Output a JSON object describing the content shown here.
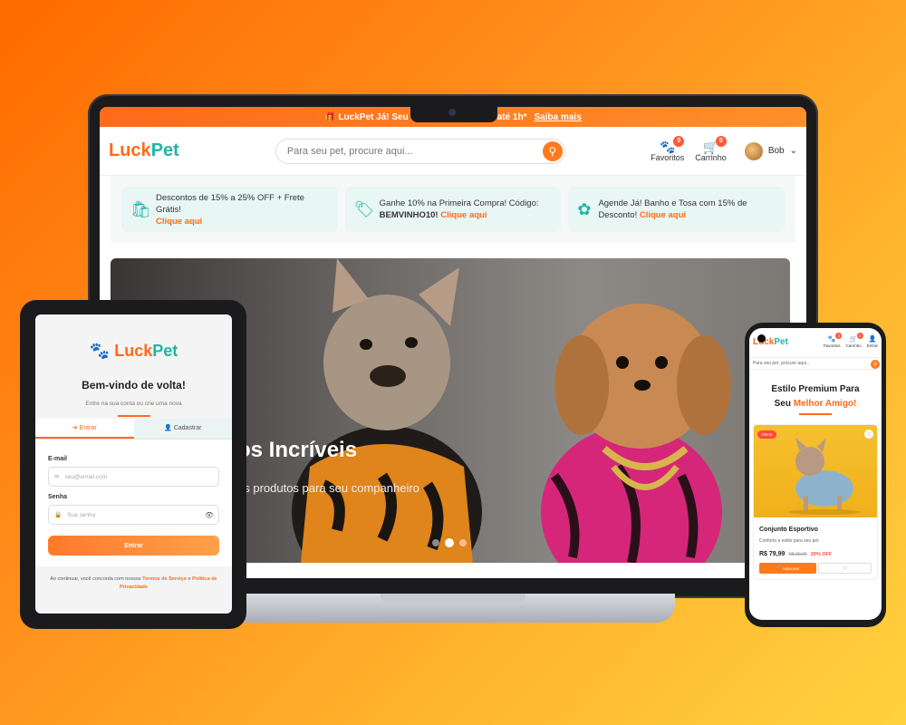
{
  "brand": {
    "part1": "Luck",
    "part2": "Pet",
    "orange": "#ff6a1a",
    "teal": "#1fb5a8"
  },
  "laptop": {
    "topbar": {
      "left": "🎁 LuckPet Já! Seu",
      "right": "até 1h*",
      "link": "Saiba mais"
    },
    "search_placeholder": "Para seu pet, procure aqui...",
    "header_icons": [
      {
        "icon": "paw-icon",
        "label": "Favoritos",
        "count": "0"
      },
      {
        "icon": "cart-icon",
        "label": "Carrinho",
        "count": "0"
      }
    ],
    "user_name": "Bob",
    "promos": [
      {
        "icon": "bag-icon",
        "text": "Descontos de 15% a 25% OFF + Frete Grátis!",
        "bold": "",
        "link": "Clique aqui"
      },
      {
        "icon": "tag-icon",
        "text": "Ganhe 10% na Primeira Compra! Código:",
        "bold": "BEMVINHO10!",
        "link": "Clique aqui"
      },
      {
        "icon": "leaf-icon",
        "text": "Agende Já! Banho e Tosa com 15% de Desconto!",
        "bold": "",
        "link": "Clique aqui"
      }
    ],
    "hero": {
      "title": "os Incríveis",
      "subtitle": "es produtos para seu companheiro"
    }
  },
  "tablet": {
    "title": "Bem-vindo de volta!",
    "subtitle": "Entre na sua conta ou crie uma nova",
    "tabs": [
      "Entrar",
      "Cadastrar"
    ],
    "email_label": "E-mail",
    "email_placeholder": "seu@email.com",
    "password_label": "Senha",
    "password_placeholder": "Sua senha",
    "submit": "Entrar",
    "footer_pre": "Ao continuar, você concorda com nossos",
    "terms": "Termos de Serviço",
    "and": "e",
    "privacy": "Política de Privacidade"
  },
  "phone": {
    "icons": [
      {
        "icon": "paw-icon",
        "label": "Favoritos",
        "count": "0"
      },
      {
        "icon": "cart-icon",
        "label": "Carrinho",
        "count": "0"
      },
      {
        "icon": "user-icon",
        "label": "Entrar",
        "count": ""
      }
    ],
    "search_placeholder": "Para seu pet, procure aqui...",
    "headline_line1": "Estilo Premium Para",
    "headline_line2_a": "Seu",
    "headline_line2_b": "Melhor Amigo!",
    "product": {
      "badge": "Oferta",
      "name": "Conjunto Esportivo",
      "desc": "Conforto e estilo para seu pet",
      "price": "R$ 79,99",
      "old_price": "R$ 99,99",
      "discount": "20% OFF",
      "add": "Adicionar"
    }
  }
}
